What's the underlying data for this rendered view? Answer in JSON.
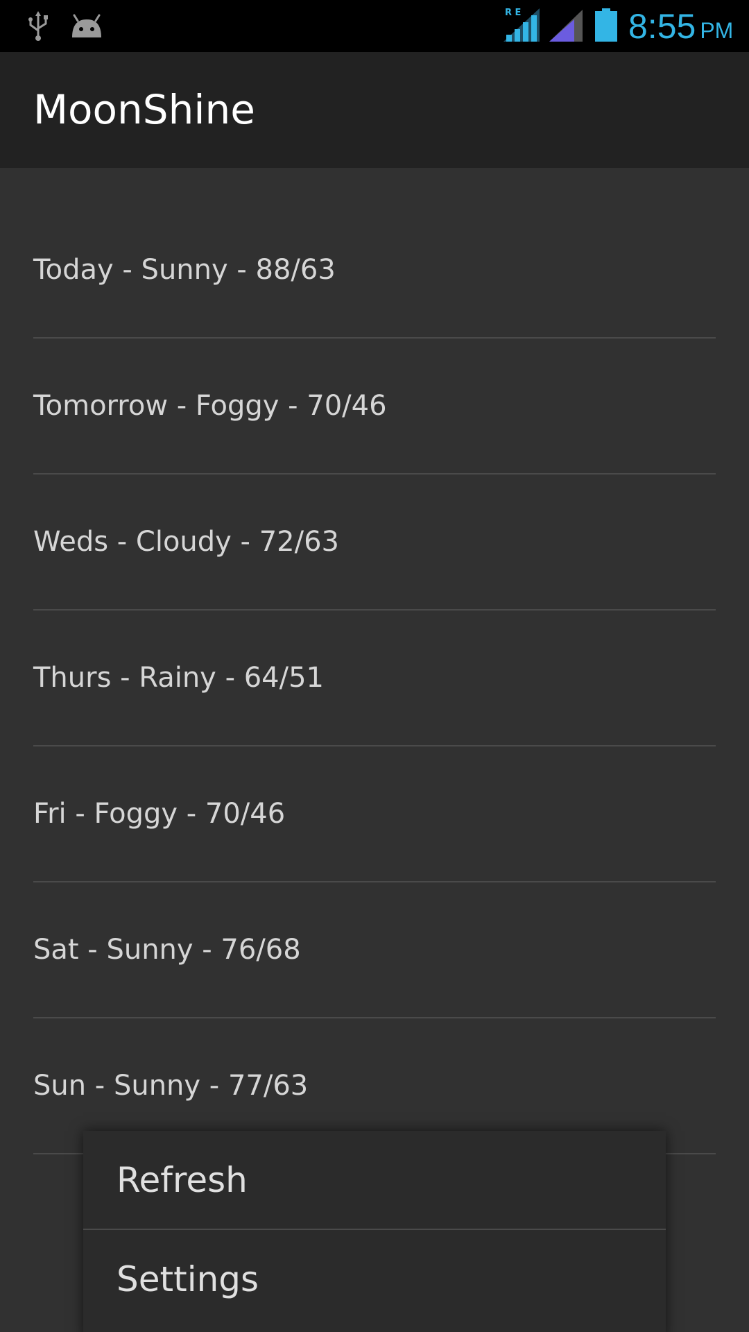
{
  "status_bar": {
    "time": "8:55",
    "ampm": "PM",
    "network_label": "R E",
    "clock_color": "#33b5e5",
    "icons": [
      "usb-icon",
      "android-debug-icon",
      "signal-roaming-icon",
      "signal-icon",
      "battery-icon"
    ]
  },
  "app": {
    "title": "MoonShine"
  },
  "forecast": {
    "items": [
      {
        "label": "Today - Sunny - 88/63"
      },
      {
        "label": "Tomorrow - Foggy - 70/46"
      },
      {
        "label": "Weds - Cloudy - 72/63"
      },
      {
        "label": "Thurs - Rainy - 64/51"
      },
      {
        "label": "Fri - Foggy - 70/46"
      },
      {
        "label": "Sat - Sunny - 76/68"
      },
      {
        "label": "Sun - Sunny - 77/63"
      }
    ]
  },
  "menu": {
    "items": [
      {
        "label": "Refresh"
      },
      {
        "label": "Settings"
      }
    ]
  }
}
